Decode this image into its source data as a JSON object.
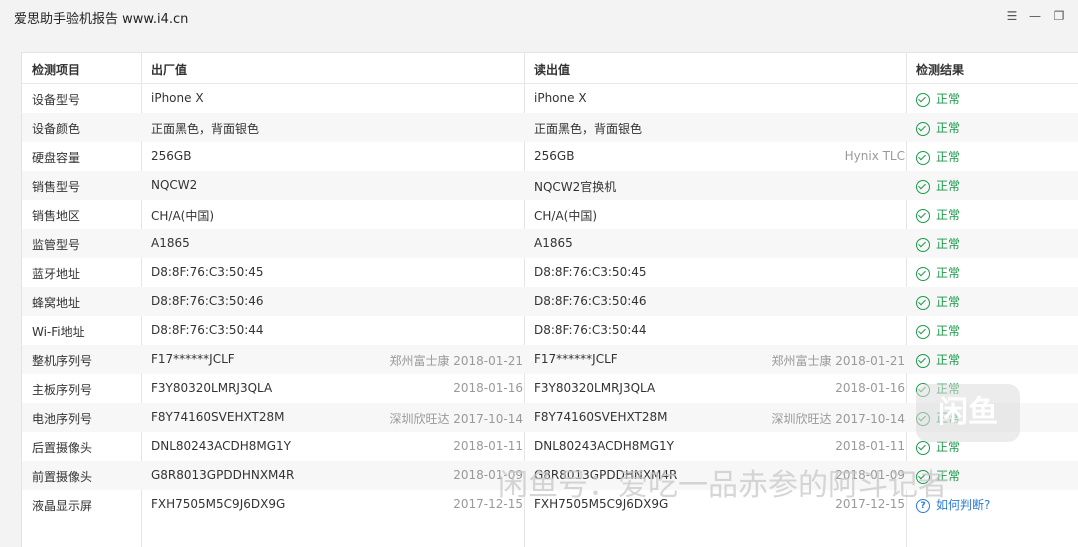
{
  "window": {
    "title": "爱思助手验机报告 www.i4.cn",
    "menu_icon": "list-icon",
    "minimize_icon": "minimize-icon",
    "restore_icon": "restore-icon"
  },
  "table": {
    "headers": [
      "检测项目",
      "出厂值",
      "读出值",
      "检测结果"
    ],
    "rows": [
      {
        "item": "设备型号",
        "factory": "iPhone X",
        "factory_extra": "",
        "read": "iPhone X",
        "read_extra": "",
        "result": "正常"
      },
      {
        "item": "设备颜色",
        "factory": "正面黑色，背面银色",
        "factory_extra": "",
        "read": "正面黑色，背面银色",
        "read_extra": "",
        "result": "正常"
      },
      {
        "item": "硬盘容量",
        "factory": "256GB",
        "factory_extra": "",
        "read": "256GB",
        "read_extra": "Hynix TLC",
        "result": "正常"
      },
      {
        "item": "销售型号",
        "factory": "NQCW2",
        "factory_extra": "",
        "read": "NQCW2官换机",
        "read_extra": "",
        "result": "正常"
      },
      {
        "item": "销售地区",
        "factory": "CH/A(中国)",
        "factory_extra": "",
        "read": "CH/A(中国)",
        "read_extra": "",
        "result": "正常"
      },
      {
        "item": "监管型号",
        "factory": "A1865",
        "factory_extra": "",
        "read": "A1865",
        "read_extra": "",
        "result": "正常"
      },
      {
        "item": "蓝牙地址",
        "factory": "D8:8F:76:C3:50:45",
        "factory_extra": "",
        "read": "D8:8F:76:C3:50:45",
        "read_extra": "",
        "result": "正常"
      },
      {
        "item": "蜂窝地址",
        "factory": "D8:8F:76:C3:50:46",
        "factory_extra": "",
        "read": "D8:8F:76:C3:50:46",
        "read_extra": "",
        "result": "正常"
      },
      {
        "item": "Wi-Fi地址",
        "factory": "D8:8F:76:C3:50:44",
        "factory_extra": "",
        "read": "D8:8F:76:C3:50:44",
        "read_extra": "",
        "result": "正常"
      },
      {
        "item": "整机序列号",
        "factory": "F17******JCLF",
        "factory_extra": "郑州富士康 2018-01-21",
        "read": "F17******JCLF",
        "read_extra": "郑州富士康 2018-01-21",
        "result": "正常"
      },
      {
        "item": "主板序列号",
        "factory": "F3Y80320LMRJ3QLA",
        "factory_extra": "2018-01-16",
        "read": "F3Y80320LMRJ3QLA",
        "read_extra": "2018-01-16",
        "result": "正常"
      },
      {
        "item": "电池序列号",
        "factory": "F8Y74160SVEHXT28M",
        "factory_extra": "深圳欣旺达 2017-10-14",
        "read": "F8Y74160SVEHXT28M",
        "read_extra": "深圳欣旺达 2017-10-14",
        "result": "正常"
      },
      {
        "item": "后置摄像头",
        "factory": "DNL80243ACDH8MG1Y",
        "factory_extra": "2018-01-11",
        "read": "DNL80243ACDH8MG1Y",
        "read_extra": "2018-01-11",
        "result": "正常"
      },
      {
        "item": "前置摄像头",
        "factory": "G8R8013GPDDHNXM4R",
        "factory_extra": "2018-01-09",
        "read": "G8R8013GPDDHNXM4R",
        "read_extra": "2018-01-09",
        "result": "正常"
      },
      {
        "item": "液晶显示屏",
        "factory": "FXH7505M5C9J6DX9G",
        "factory_extra": "2017-12-15",
        "read": "FXH7505M5C9J6DX9G",
        "read_extra": "2017-12-15",
        "result": "如何判断?"
      }
    ]
  },
  "watermark": {
    "badge": "闲鱼",
    "text": "闲鱼号：爱吃一品赤参的阿斗记者"
  },
  "colors": {
    "ok_green": "#1a9a4b",
    "link_blue": "#2b7cd3",
    "extra_gray": "#999999"
  }
}
